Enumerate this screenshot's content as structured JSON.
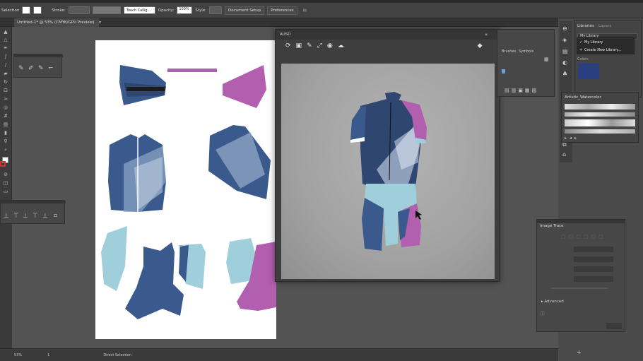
{
  "control_bar": {
    "selection_label": "Selection",
    "stroke_label": "Stroke:",
    "brush_label": "Touch Callig...",
    "opacity_label": "Opacity:",
    "opacity_value": "100%",
    "style_label": "Style:",
    "document_setup": "Document Setup",
    "preferences": "Preferences"
  },
  "document_tab": {
    "title": "Untitled-1* @ 53% (CMYK/GPU Preview)"
  },
  "window_3d": {
    "title": "AUSD"
  },
  "midpanel": {
    "tab_brushes": "Brushes",
    "tab_symbols": "Symbols"
  },
  "libraries_panel": {
    "tab_libraries": "Libraries",
    "tab_layers": "Layers",
    "selected": "My Library",
    "menu_item_1": "My Library",
    "menu_item_2": "Create New Library...",
    "section_colors": "Colors"
  },
  "artistic_panel": {
    "title": "Artistic_Watercolor"
  },
  "image_trace": {
    "title": "Image Trace",
    "advanced_label": "Advanced"
  },
  "status_bar": {
    "zoom": "53%",
    "page": "1",
    "tool_name": "Direct Selection"
  },
  "colors": {
    "navy": "#3a5a8e",
    "dark_navy": "#2f4670",
    "purple": "#b15fae",
    "light_blue": "#9fcfdb",
    "library_swatch": "#2a3f80"
  }
}
